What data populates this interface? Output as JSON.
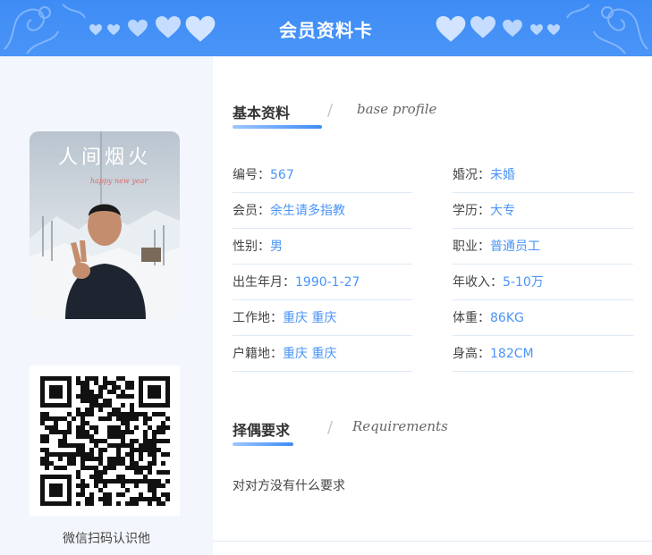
{
  "header": {
    "title": "会员资料卡",
    "accent": "#3d8cf5"
  },
  "profile": {
    "photo_title": "人间烟火",
    "photo_script": "happy new year"
  },
  "qr": {
    "caption": "微信扫码认识他"
  },
  "basic": {
    "title": "基本资料",
    "subtitle": "base profile",
    "left": [
      {
        "key": "编号：",
        "value": "567"
      },
      {
        "key": "会员：",
        "value": "余生请多指教"
      },
      {
        "key": "性别：",
        "value": "男"
      },
      {
        "key": "出生年月：",
        "value": "1990-1-27"
      },
      {
        "key": "工作地：",
        "value": "重庆 重庆"
      },
      {
        "key": "户籍地：",
        "value": "重庆 重庆"
      }
    ],
    "right": [
      {
        "key": "婚况：",
        "value": "未婚"
      },
      {
        "key": "学历：",
        "value": "大专"
      },
      {
        "key": "职业：",
        "value": "普通员工"
      },
      {
        "key": "年收入：",
        "value": "5-10万"
      },
      {
        "key": "体重：",
        "value": "86KG"
      },
      {
        "key": "身高：",
        "value": "182CM"
      }
    ]
  },
  "requirements": {
    "title": "择偶要求",
    "subtitle": "Requirements",
    "text": "对对方没有什么要求"
  }
}
